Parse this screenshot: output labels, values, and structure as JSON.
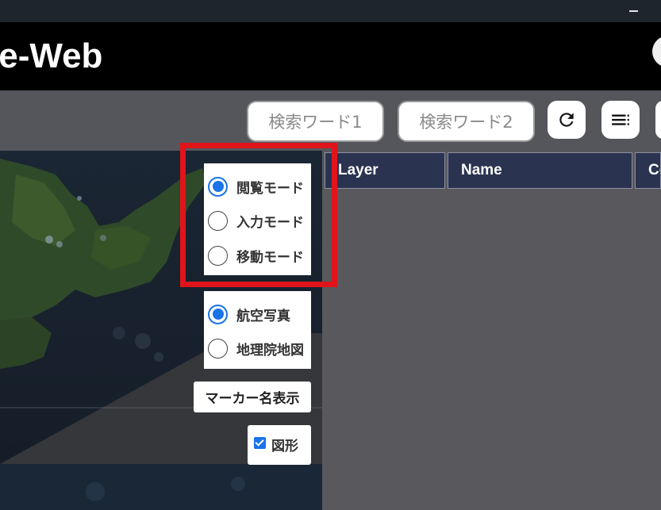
{
  "window": {
    "minimize_icon": "minimize-icon"
  },
  "header": {
    "title": "le-Web"
  },
  "toolbar": {
    "search1_placeholder": "検索ワード1",
    "search2_placeholder": "検索ワード2",
    "refresh_icon": "refresh-icon",
    "list_icon": "list-icon"
  },
  "table": {
    "columns": [
      "Layer",
      "Name",
      "Co"
    ]
  },
  "mode_selector": {
    "options": [
      "閲覧モード",
      "入力モード",
      "移動モード"
    ],
    "selected": "閲覧モード"
  },
  "base_map_selector": {
    "options": [
      "航空写真",
      "地理院地図"
    ],
    "selected": "航空写真"
  },
  "marker_button_label": "マーカー名表示",
  "shape_toggle": {
    "label": "図形",
    "checked": true
  },
  "colors": {
    "accent": "#1a73e8",
    "highlight": "#e0141b",
    "table_header": "#2a3350"
  }
}
